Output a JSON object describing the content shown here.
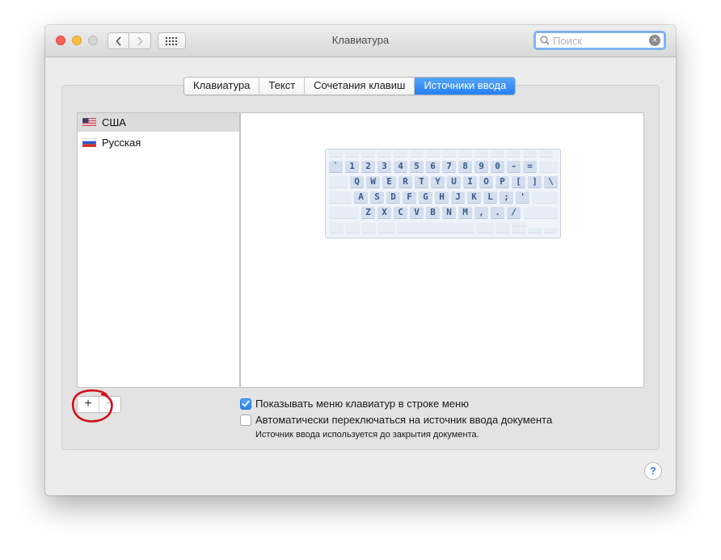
{
  "window": {
    "title": "Клавиатура",
    "search": {
      "placeholder": "Поиск",
      "value": ""
    }
  },
  "tabs": [
    {
      "label": "Клавиатура",
      "active": false
    },
    {
      "label": "Текст",
      "active": false
    },
    {
      "label": "Сочетания клавиш",
      "active": false
    },
    {
      "label": "Источники ввода",
      "active": true
    }
  ],
  "sources": [
    {
      "label": "США",
      "flag": "us-flag-icon",
      "selected": true
    },
    {
      "label": "Русская",
      "flag": "ru-flag-icon",
      "selected": false
    }
  ],
  "keyboard": {
    "rows": [
      [
        "`",
        "1",
        "2",
        "3",
        "4",
        "5",
        "6",
        "7",
        "8",
        "9",
        "0",
        "-",
        "="
      ],
      [
        "Q",
        "W",
        "E",
        "R",
        "T",
        "Y",
        "U",
        "I",
        "O",
        "P",
        "[",
        "]",
        "\\"
      ],
      [
        "A",
        "S",
        "D",
        "F",
        "G",
        "H",
        "J",
        "K",
        "L",
        ";",
        "'"
      ],
      [
        "Z",
        "X",
        "C",
        "V",
        "B",
        "N",
        "M",
        ",",
        ".",
        "/"
      ]
    ]
  },
  "buttons": {
    "add": "+",
    "remove": "−",
    "help": "?"
  },
  "options": {
    "show_menu": {
      "label": "Показывать меню клавиатур в строке меню",
      "checked": true
    },
    "auto_switch": {
      "label": "Автоматически переключаться на источник ввода документа",
      "checked": false
    },
    "auto_switch_note": "Источник ввода используется до закрытия документа."
  },
  "colors": {
    "accent": "#2a83f1",
    "annotation": "#d0101b",
    "key_text": "#3a5b8c"
  }
}
